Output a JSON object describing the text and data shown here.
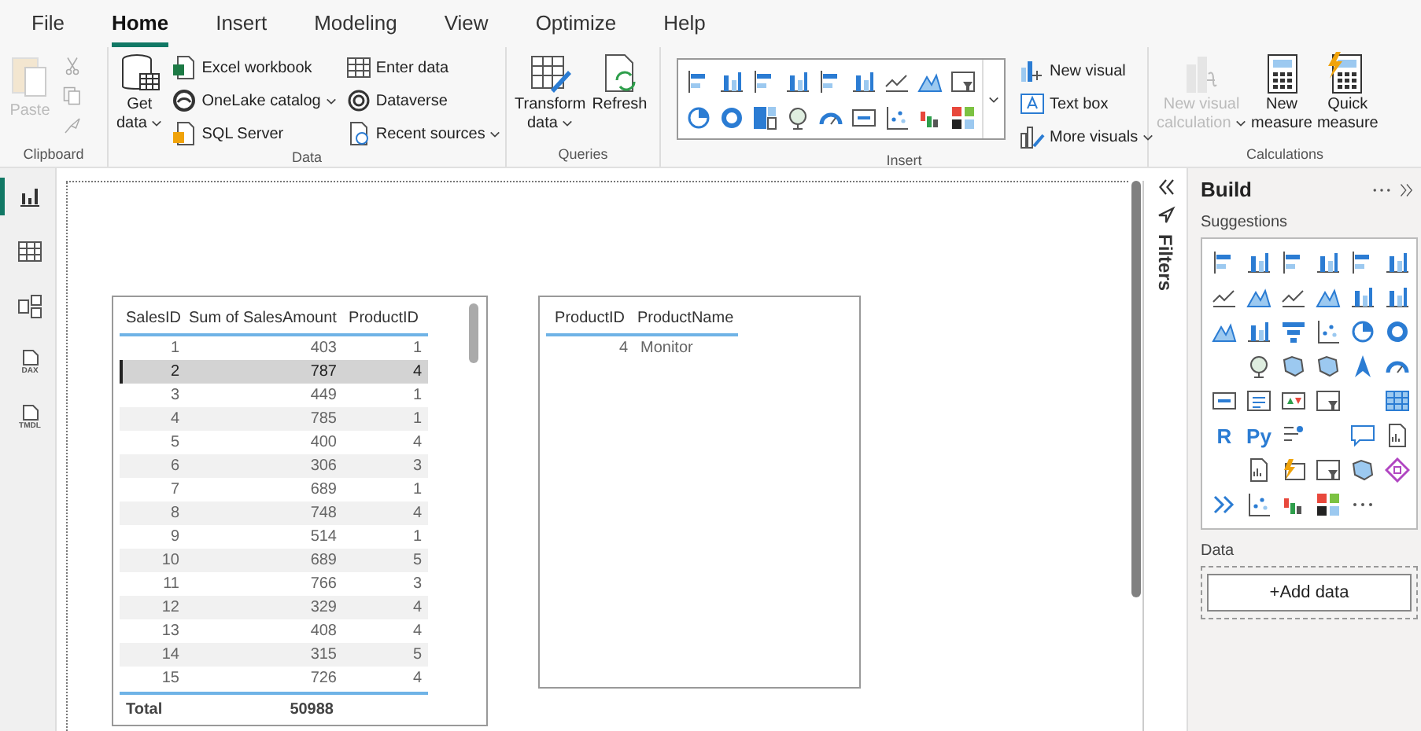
{
  "menu_tabs": [
    {
      "label": "File",
      "selected": false
    },
    {
      "label": "Home",
      "selected": true
    },
    {
      "label": "Insert",
      "selected": false
    },
    {
      "label": "Modeling",
      "selected": false
    },
    {
      "label": "View",
      "selected": false
    },
    {
      "label": "Optimize",
      "selected": false
    },
    {
      "label": "Help",
      "selected": false
    }
  ],
  "ribbon": {
    "clipboard": {
      "label": "Clipboard",
      "paste": {
        "label": "Paste",
        "disabled": true
      }
    },
    "data": {
      "label": "Data",
      "get_data": {
        "lines": [
          "Get",
          "data"
        ],
        "menu": true
      },
      "sources": [
        {
          "label": "Excel workbook",
          "menu": false
        },
        {
          "label": "OneLake catalog",
          "menu": true
        },
        {
          "label": "SQL Server",
          "menu": false
        },
        {
          "label": "Enter data",
          "menu": false
        },
        {
          "label": "Dataverse",
          "menu": false
        },
        {
          "label": "Recent sources",
          "menu": true
        }
      ]
    },
    "queries": {
      "label": "Queries",
      "buttons": [
        {
          "lines": [
            "Transform",
            "data"
          ],
          "menu": true
        },
        {
          "lines": [
            "Refresh"
          ],
          "menu": false
        }
      ]
    },
    "insert": {
      "label": "Insert",
      "actions": [
        {
          "label": "New visual",
          "menu": false
        },
        {
          "label": "Text box",
          "menu": false
        },
        {
          "label": "More visuals",
          "menu": true
        }
      ]
    },
    "calculations": {
      "label": "Calculations",
      "buttons": [
        {
          "lines": [
            "New visual",
            "calculation"
          ],
          "menu": true,
          "disabled": true
        },
        {
          "lines": [
            "New",
            "measure"
          ],
          "menu": false,
          "disabled": false
        },
        {
          "lines": [
            "Quick",
            "measure"
          ],
          "menu": false,
          "disabled": false
        }
      ]
    }
  },
  "nav": [
    {
      "selected": true
    },
    {
      "selected": false
    },
    {
      "selected": false
    },
    {
      "selected": false,
      "badge": "DAX"
    },
    {
      "selected": false,
      "badge": "TMDL"
    }
  ],
  "sales_table": {
    "columns": [
      "SalesID",
      "Sum of SalesAmount",
      "ProductID"
    ],
    "rows": [
      {
        "cells": [
          "1",
          "403",
          "1"
        ],
        "selected": false
      },
      {
        "cells": [
          "2",
          "787",
          "4"
        ],
        "selected": true
      },
      {
        "cells": [
          "3",
          "449",
          "1"
        ],
        "selected": false
      },
      {
        "cells": [
          "4",
          "785",
          "1"
        ],
        "selected": false
      },
      {
        "cells": [
          "5",
          "400",
          "4"
        ],
        "selected": false
      },
      {
        "cells": [
          "6",
          "306",
          "3"
        ],
        "selected": false
      },
      {
        "cells": [
          "7",
          "689",
          "1"
        ],
        "selected": false
      },
      {
        "cells": [
          "8",
          "748",
          "4"
        ],
        "selected": false
      },
      {
        "cells": [
          "9",
          "514",
          "1"
        ],
        "selected": false
      },
      {
        "cells": [
          "10",
          "689",
          "5"
        ],
        "selected": false
      },
      {
        "cells": [
          "11",
          "766",
          "3"
        ],
        "selected": false
      },
      {
        "cells": [
          "12",
          "329",
          "4"
        ],
        "selected": false
      },
      {
        "cells": [
          "13",
          "408",
          "4"
        ],
        "selected": false
      },
      {
        "cells": [
          "14",
          "315",
          "5"
        ],
        "selected": false
      },
      {
        "cells": [
          "15",
          "726",
          "4"
        ],
        "selected": false
      }
    ],
    "total": {
      "label": "Total",
      "sum": "50988"
    }
  },
  "product_table": {
    "columns": [
      "ProductID",
      "ProductName"
    ],
    "rows": [
      {
        "cells": [
          "4",
          "Monitor"
        ]
      }
    ]
  },
  "filters": {
    "label": "Filters"
  },
  "build": {
    "title": "Build",
    "suggestions_label": "Suggestions",
    "text_icons": [
      "R",
      "Py"
    ],
    "data_label": "Data",
    "add_button": "+Add data"
  }
}
